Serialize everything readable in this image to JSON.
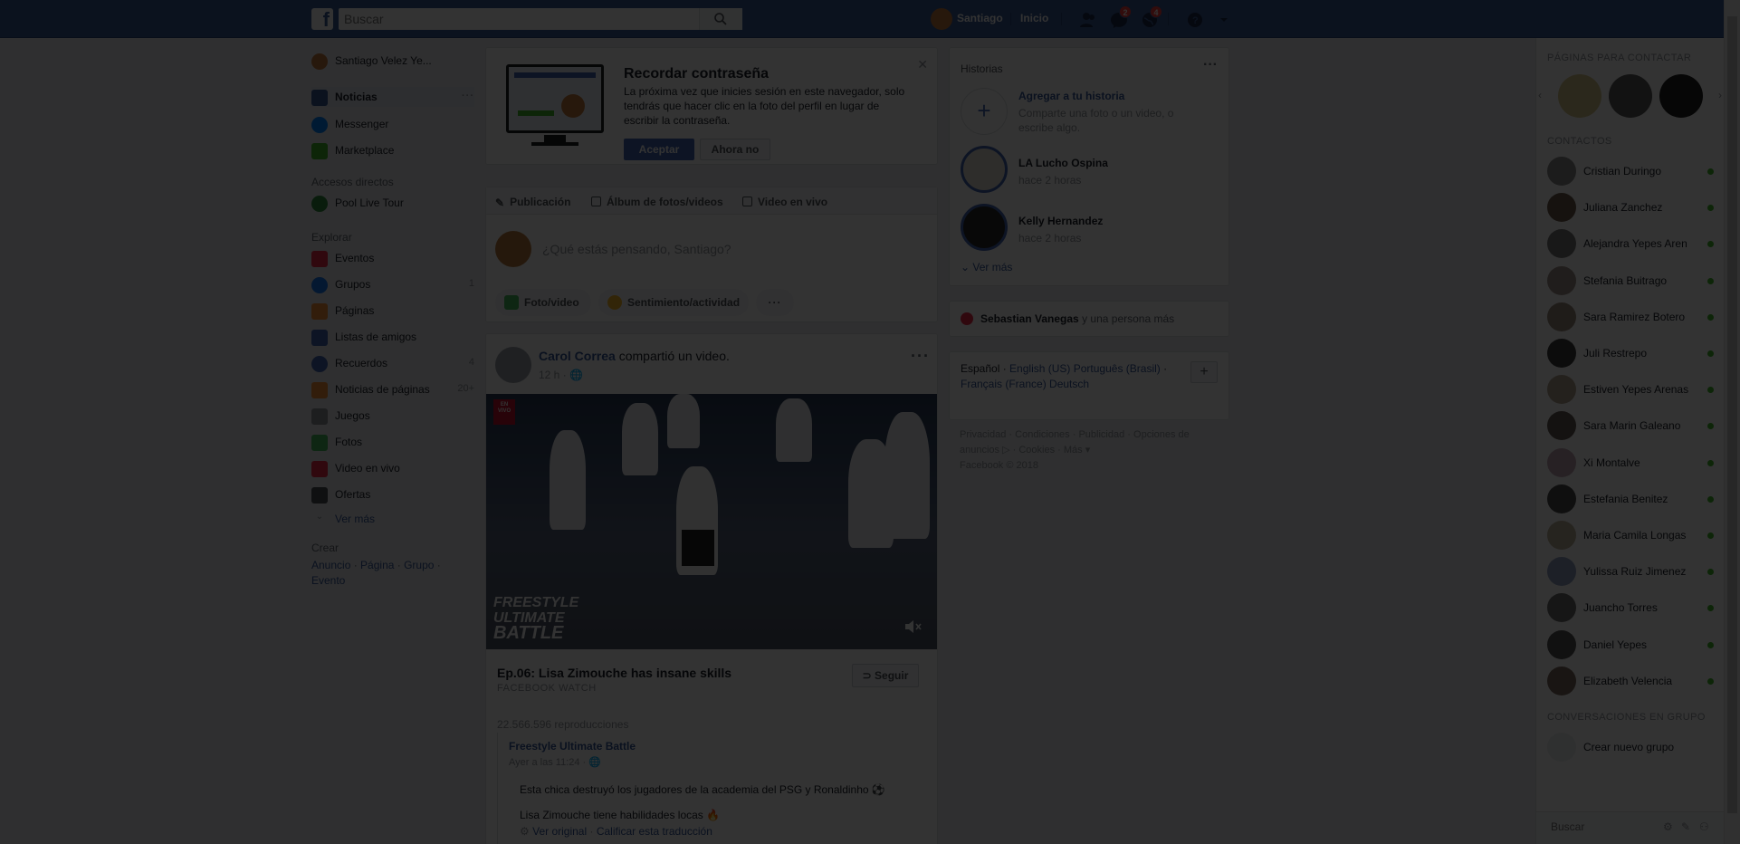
{
  "topbar": {
    "logo": "f",
    "search_placeholder": "Buscar",
    "user_name": "Santiago",
    "home_label": "Inicio",
    "messages_badge": "2",
    "notifications_badge": "4"
  },
  "leftnav": {
    "profile_name": "Santiago Velez Ye...",
    "items": [
      {
        "label": "Noticias",
        "icon": "news-feed-icon",
        "color": "#3b5998"
      },
      {
        "label": "Messenger",
        "icon": "messenger-icon",
        "color": "#0084ff"
      },
      {
        "label": "Marketplace",
        "icon": "marketplace-icon",
        "color": "#42b72a"
      }
    ],
    "shortcuts_heading": "Accesos directos",
    "shortcuts": [
      {
        "label": "Pool Live Tour",
        "icon": "pool-icon"
      }
    ],
    "explore_heading": "Explorar",
    "explore": [
      {
        "label": "Eventos",
        "icon": "calendar-icon",
        "color": "#f02849",
        "count": ""
      },
      {
        "label": "Grupos",
        "icon": "groups-icon",
        "color": "#1877f2",
        "count": "1"
      },
      {
        "label": "Páginas",
        "icon": "flag-icon",
        "color": "#f7923b",
        "count": ""
      },
      {
        "label": "Listas de amigos",
        "icon": "friends-list-icon",
        "color": "#4267b2",
        "count": ""
      },
      {
        "label": "Recuerdos",
        "icon": "memories-icon",
        "color": "#4267b2",
        "count": "4"
      },
      {
        "label": "Noticias de páginas",
        "icon": "page-feed-icon",
        "color": "#f7923b",
        "count": "20+"
      },
      {
        "label": "Juegos",
        "icon": "games-icon",
        "color": "#90949c",
        "count": ""
      },
      {
        "label": "Fotos",
        "icon": "photos-icon",
        "color": "#45bd62",
        "count": ""
      },
      {
        "label": "Video en vivo",
        "icon": "live-video-icon",
        "color": "#f02849",
        "count": ""
      },
      {
        "label": "Ofertas",
        "icon": "offers-icon",
        "color": "#4b4f56",
        "count": ""
      }
    ],
    "see_more": "Ver más",
    "create_heading": "Crear",
    "create_links": [
      "Anuncio",
      "Página",
      "Grupo",
      "Evento"
    ]
  },
  "password_card": {
    "title": "Recordar contraseña",
    "text": "La próxima vez que inicies sesión en este navegador, solo tendrás que hacer clic en la foto del perfil en lugar de escribir la contraseña.",
    "accept": "Aceptar",
    "decline": "Ahora no"
  },
  "composer": {
    "tabs": [
      "Publicación",
      "Álbum de fotos/videos",
      "Video en vivo"
    ],
    "placeholder": "¿Qué estás pensando, Santiago?",
    "actions": [
      "Foto/video",
      "Sentimiento/actividad"
    ],
    "more": "···"
  },
  "post": {
    "author": "Carol Correa",
    "action": "compartió un video.",
    "time": "12 h",
    "video_badge": "EN VIVO",
    "video_logo": [
      "FREESTYLE",
      "ULTIMATE",
      "BATTLE"
    ],
    "title": "Ep.06: Lisa Zimouche has insane skills",
    "source": "FACEBOOK WATCH",
    "follow": "Seguir",
    "views": "22.566.596 reproducciones",
    "shared_title": "Freestyle Ultimate Battle",
    "shared_time": "Ayer a las 11:24",
    "text1": "Esta chica destruyó los jugadores de la academia del PSG y Ronaldinho",
    "text2": "Lisa Zimouche tiene habilidades locas",
    "see_original": "Ver original",
    "rate_translation": "Calificar esta traducción"
  },
  "stories": {
    "heading": "Historias",
    "add_title": "Agregar a tu historia",
    "add_sub": "Comparte una foto o un video, o escribe algo.",
    "items": [
      {
        "name": "LA Lucho Ospina",
        "time": "hace 2 horas"
      },
      {
        "name": "Kelly Hernandez",
        "time": "hace 2 horas"
      }
    ],
    "see_more": "Ver más"
  },
  "birthday": {
    "name": "Sebastian Vanegas",
    "rest": "y una persona más"
  },
  "languages": {
    "current": "Español",
    "others": [
      "English (US)",
      "Português (Brasil)",
      "Français (France)",
      "Deutsch"
    ]
  },
  "footer": {
    "links": [
      "Privacidad",
      "Condiciones",
      "Publicidad",
      "Opciones de anuncios",
      "Cookies",
      "Más"
    ],
    "copyright": "Facebook © 2018"
  },
  "chat": {
    "pages_heading": "PÁGINAS PARA CONTACTAR",
    "contacts_heading": "CONTACTOS",
    "contacts": [
      "Cristian Duringo",
      "Juliana Zanchez",
      "Alejandra Yepes Aren",
      "Stefania Buitrago",
      "Sara Ramirez Botero",
      "Juli Restrepo",
      "Estiven Yepes Arenas",
      "Sara Marin Galeano",
      "Xi Montalve",
      "Estefania Benitez",
      "Maria Camila Longas",
      "Yulissa Ruiz Jimenez",
      "Juancho Torres",
      "Daniel Yepes",
      "Elizabeth Velencia"
    ],
    "groups_heading": "CONVERSACIONES EN GRUPO",
    "create_group": "Crear nuevo grupo",
    "search_placeholder": "Buscar"
  }
}
